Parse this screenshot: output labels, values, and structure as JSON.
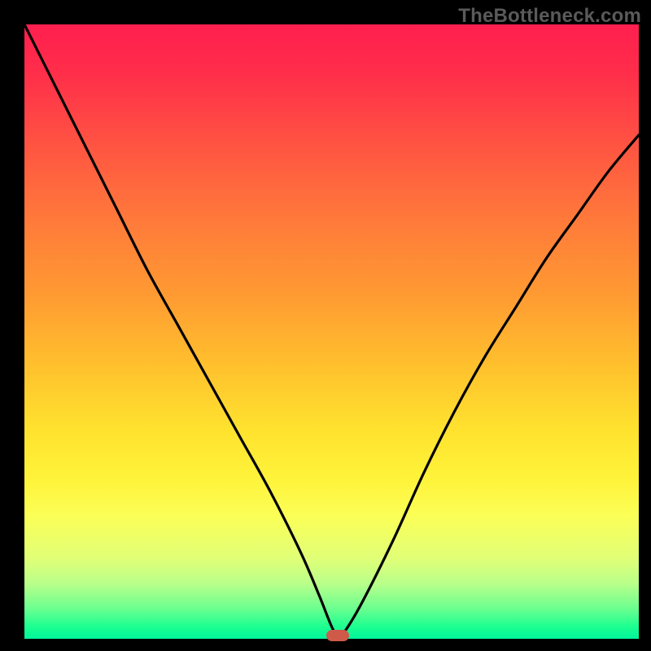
{
  "watermark": "TheBottleneck.com",
  "chart_data": {
    "type": "line",
    "title": "",
    "xlabel": "",
    "ylabel": "",
    "xlim": [
      0,
      100
    ],
    "ylim": [
      0,
      100
    ],
    "grid": false,
    "series": [
      {
        "name": "bottleneck-curve",
        "x": [
          0,
          5,
          10,
          15,
          20,
          25,
          30,
          35,
          40,
          45,
          48,
          50,
          51,
          52,
          55,
          60,
          65,
          70,
          75,
          80,
          85,
          90,
          95,
          100
        ],
        "y": [
          100,
          90,
          80,
          70,
          60,
          51,
          42,
          33,
          24,
          14,
          7,
          2,
          0.5,
          1,
          6,
          16,
          27,
          37,
          46,
          54,
          62,
          69,
          76,
          82
        ]
      }
    ],
    "background_gradient": {
      "top_color": "#ff1f4f",
      "bottom_color": "#00f59a",
      "note": "red (top) to green (bottom) vertical gradient"
    },
    "marker": {
      "name": "optimal-point",
      "x": 51,
      "y": 0.5,
      "color": "#cf5a4a",
      "shape": "rounded-rect"
    }
  }
}
